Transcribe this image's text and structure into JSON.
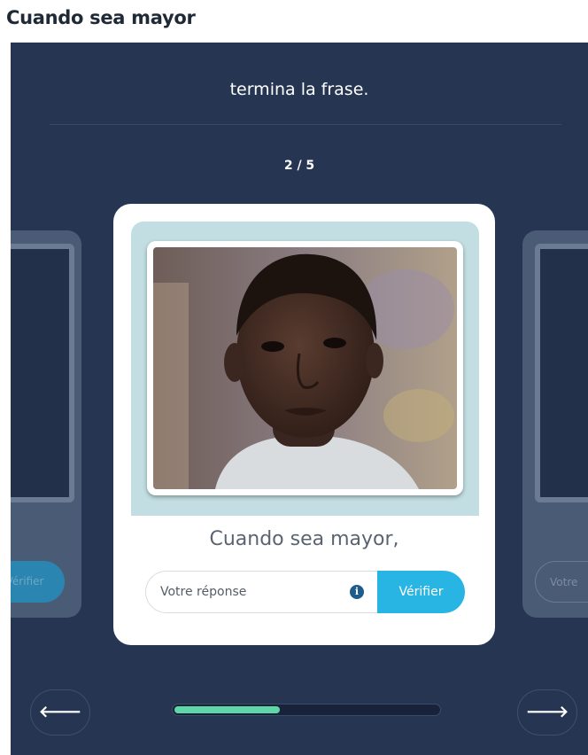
{
  "page": {
    "title": "Cuando sea mayor"
  },
  "exercise": {
    "instruction": "termina la frase.",
    "counter": "2 / 5",
    "progress": 0.4
  },
  "card": {
    "prompt": "Cuando sea mayor,",
    "input_placeholder": "Votre réponse",
    "verify_label": "Vérifier",
    "info_icon": "info-icon"
  },
  "side_cards": {
    "left_button_label": "Vérifier",
    "right_input_placeholder": "Votre"
  },
  "nav": {
    "prev_icon": "arrow-left-icon",
    "next_icon": "arrow-right-icon",
    "prev_glyph": "🡐",
    "next_glyph": "🡒"
  },
  "colors": {
    "panel": "#263552",
    "accent": "#29b5e4",
    "progress": "#5ed6a8",
    "photo_bg": "#c2dee2"
  }
}
